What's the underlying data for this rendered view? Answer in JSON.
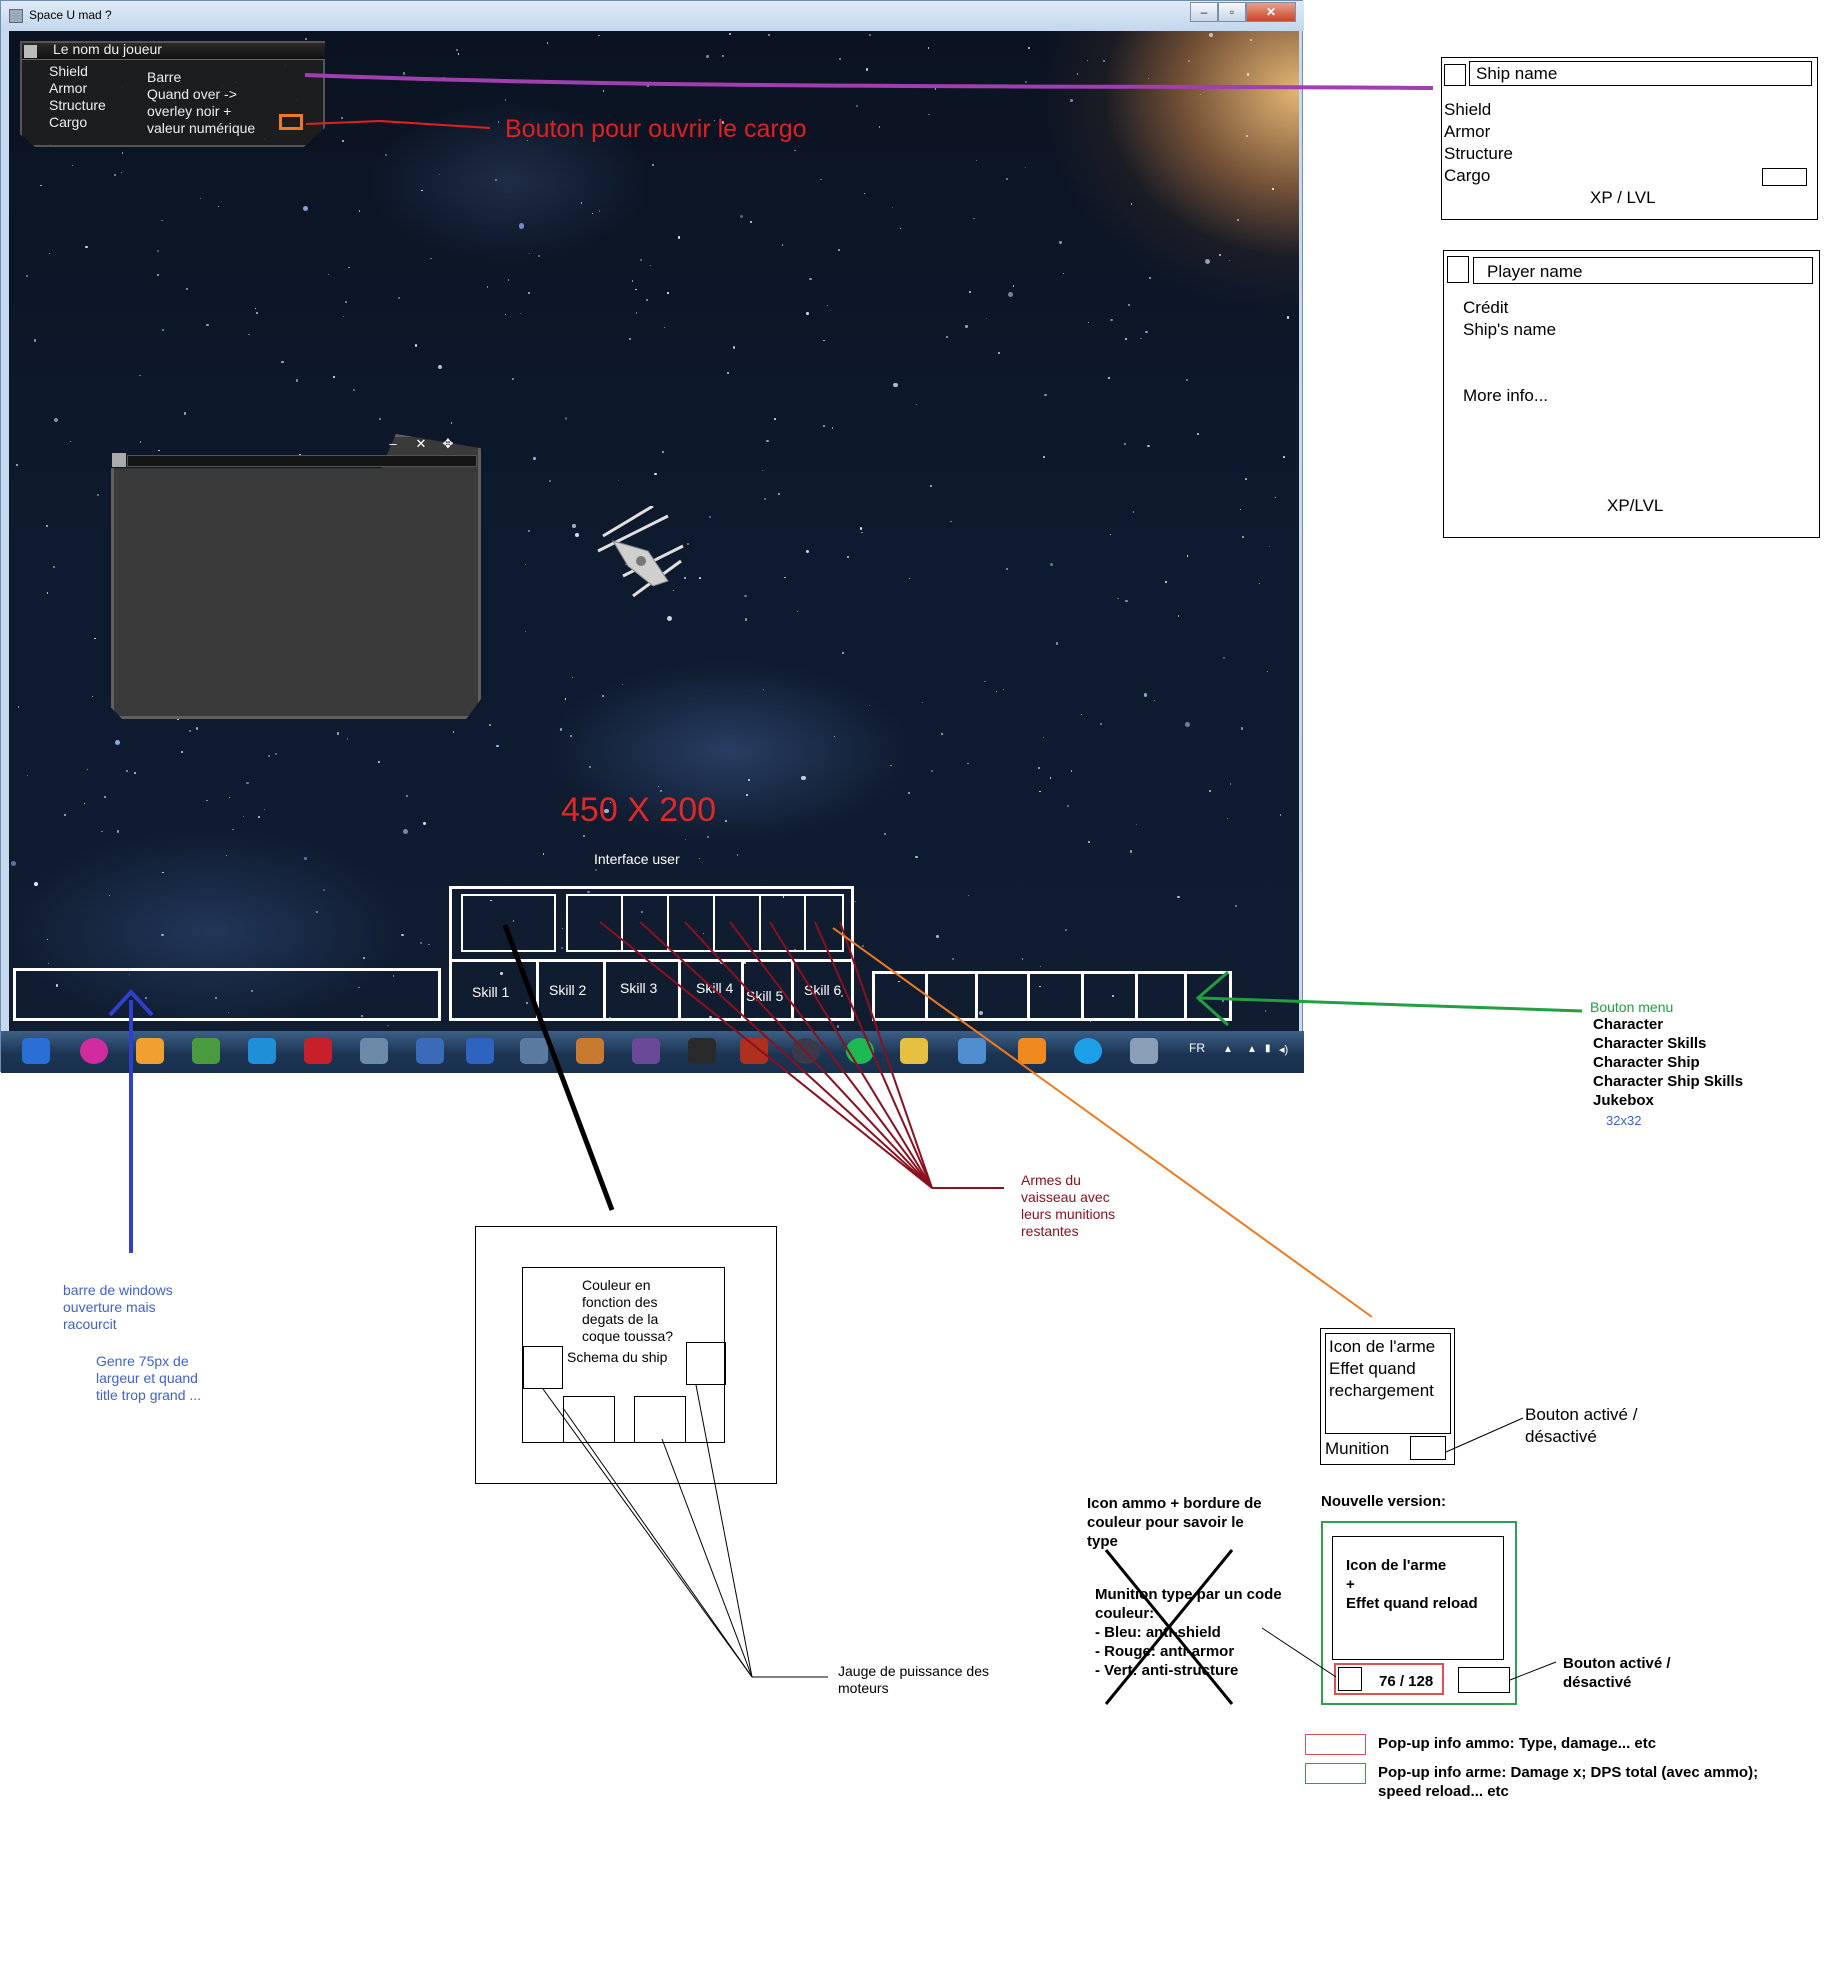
{
  "window": {
    "title": "Space U mad ?",
    "controls": [
      "–",
      "▫",
      "✕"
    ]
  },
  "player_panel": {
    "title": "Le nom du joueur",
    "stats": [
      "Shield",
      "Armor",
      "Structure",
      "Cargo"
    ],
    "bar_note": [
      "Barre",
      "Quand over ->",
      "overley noir +",
      "valeur numérique"
    ]
  },
  "floating_window": {
    "controls": [
      "–",
      "✕",
      "✥"
    ]
  },
  "center": {
    "size_label": "450 X 200",
    "interface_label": "Interface user",
    "skills": [
      "Skill 1",
      "Skill 2",
      "Skill 3",
      "Skill 4",
      "Skill 5",
      "Skill 6"
    ]
  },
  "taskbar": {
    "lang": "FR",
    "icons": [
      "jetbrains-icon",
      "uninstaller-icon",
      "mail-icon",
      "notepad-icon",
      "virtualbox-icon",
      "filezilla-icon",
      "network-icon",
      "remote-icon",
      "powershell-icon",
      "calculator-icon",
      "paint-icon",
      "code-icon",
      "terminal-icon",
      "diablo-icon",
      "steam-icon",
      "spotify-icon",
      "folder-icon",
      "photos-icon",
      "media-icon",
      "skype-icon",
      "desktop-icon"
    ],
    "tray": [
      "▲",
      "▲",
      "▮",
      "◂)"
    ]
  },
  "annotations": {
    "cargo_button": "Bouton pour ouvrir le cargo",
    "ship_panel": {
      "name": "Ship name",
      "stats": [
        "Shield",
        "Armor",
        "Structure",
        "Cargo"
      ],
      "xp": "XP / LVL"
    },
    "player_info": {
      "name": "Player name",
      "lines": [
        "Crédit",
        "Ship's name"
      ],
      "more": "More info...",
      "xp": "XP/LVL"
    },
    "menu": {
      "title": "Bouton menu",
      "items": [
        "Character",
        "Character Skills",
        "Character Ship",
        "Character Ship Skills",
        "Jukebox"
      ],
      "size": "32x32"
    },
    "windows_bar": {
      "lines": [
        "barre de windows",
        "ouverture mais",
        "racourcit"
      ],
      "lines2": [
        "Genre 75px de",
        "largeur et quand",
        "title trop grand ..."
      ]
    },
    "ship_schema": {
      "lines": [
        "Couleur en",
        "fonction des",
        "degats de la",
        "coque toussa?"
      ],
      "label": "Schema du ship"
    },
    "engine_gauge": [
      "Jauge de puissance des",
      "moteurs"
    ],
    "weapons": [
      "Armes du",
      "vaisseau avec",
      "leurs munitions",
      "restantes"
    ],
    "weapon_box": {
      "lines": [
        "Icon de l'arme",
        "Effet quand",
        "rechargement"
      ],
      "ammo": "Munition",
      "toggle": [
        "Bouton activé /",
        "désactivé"
      ]
    },
    "new_version": {
      "title": "Nouvelle version:",
      "icon_lines": [
        "Icon de l'arme",
        "+",
        "Effet quand reload"
      ],
      "ammo_count": "76 / 128",
      "toggle": [
        "Bouton activé /",
        "désactivé"
      ]
    },
    "ammo_icon_note": [
      "Icon ammo + bordure de",
      "couleur pour savoir le",
      "type"
    ],
    "ammo_color_code": [
      "Munition type par un code",
      "couleur:",
      "- Bleu: anti-shield",
      "- Rouge: anti-armor",
      "- Vert: anti-structure"
    ],
    "legend": {
      "red": "Pop-up info ammo: Type, damage... etc",
      "green_1": "Pop-up info arme: Damage x; DPS total (avec ammo);",
      "green_2": "speed reload... etc"
    }
  },
  "colors": {
    "purple": "#a040b0",
    "red": "#e02020",
    "dark_red": "#8b1020",
    "orange": "#f07a20",
    "green": "#20a040",
    "blue": "#3040c8",
    "annotation_blue": "#4060d0",
    "legend_red": "#e05050",
    "legend_green": "#30a050"
  }
}
